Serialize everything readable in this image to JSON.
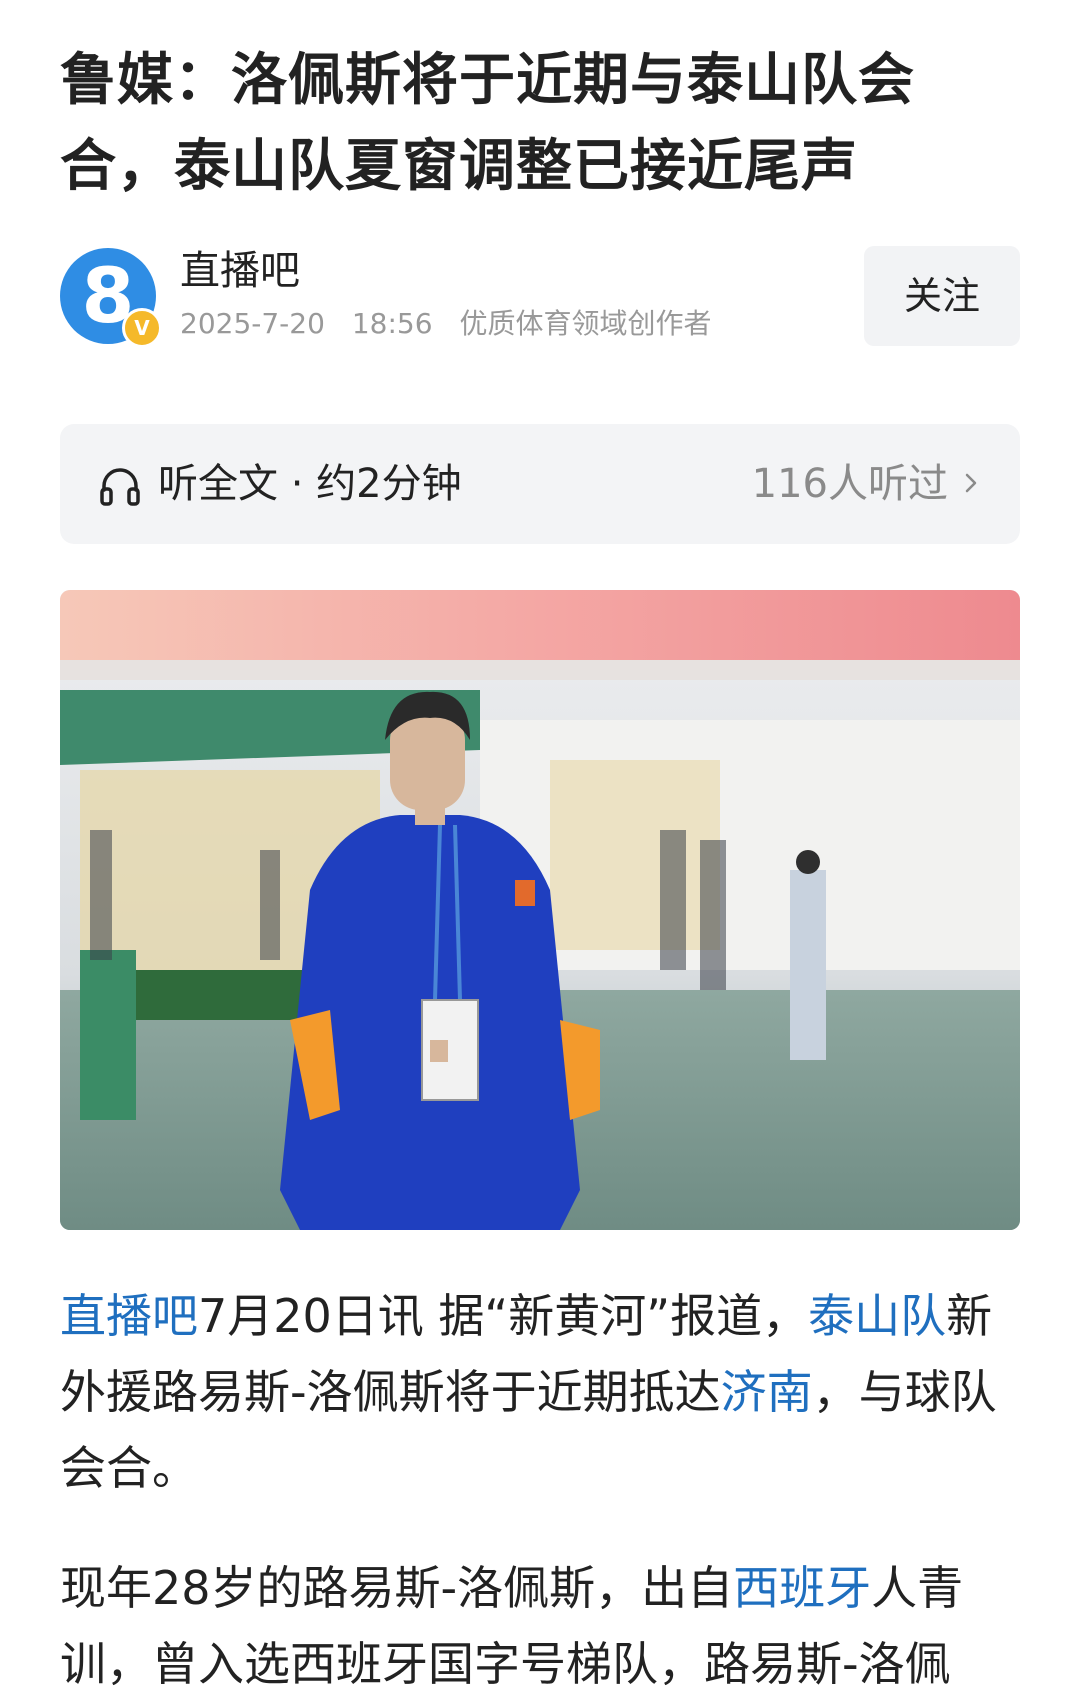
{
  "article": {
    "title": "鲁媒：洛佩斯将于近期与泰山队会合，泰山队夏窗调整已接近尾声"
  },
  "author": {
    "avatar_glyph": "8",
    "verified_glyph": "V",
    "name": "直播吧",
    "date": "2025-7-20",
    "time": "18:56",
    "tag": "优质体育领域创作者",
    "follow_label": "关注"
  },
  "listen": {
    "label": "听全文 · 约2分钟",
    "count": "116人听过",
    "icon": "headphones-icon"
  },
  "body": {
    "p1": [
      {
        "text": "直播吧",
        "link": true
      },
      {
        "text": "7月20日讯 据“新黄河”报道，",
        "link": false
      },
      {
        "text": "泰山队",
        "link": true
      },
      {
        "text": "新外援路易斯-洛佩斯将于近期抵达",
        "link": false
      },
      {
        "text": "济南",
        "link": true
      },
      {
        "text": "，与球队会合。",
        "link": false
      }
    ],
    "p2": [
      {
        "text": "现年28岁的路易斯-洛佩斯，出自",
        "link": false
      },
      {
        "text": "西班牙",
        "link": true
      },
      {
        "text": "人青训，曾入选西班牙国字号梯队，路易斯-洛佩",
        "link": false
      }
    ]
  },
  "colors": {
    "link": "#1f6fbf",
    "avatar": "#2f8de4",
    "badge": "#f5b92a"
  }
}
